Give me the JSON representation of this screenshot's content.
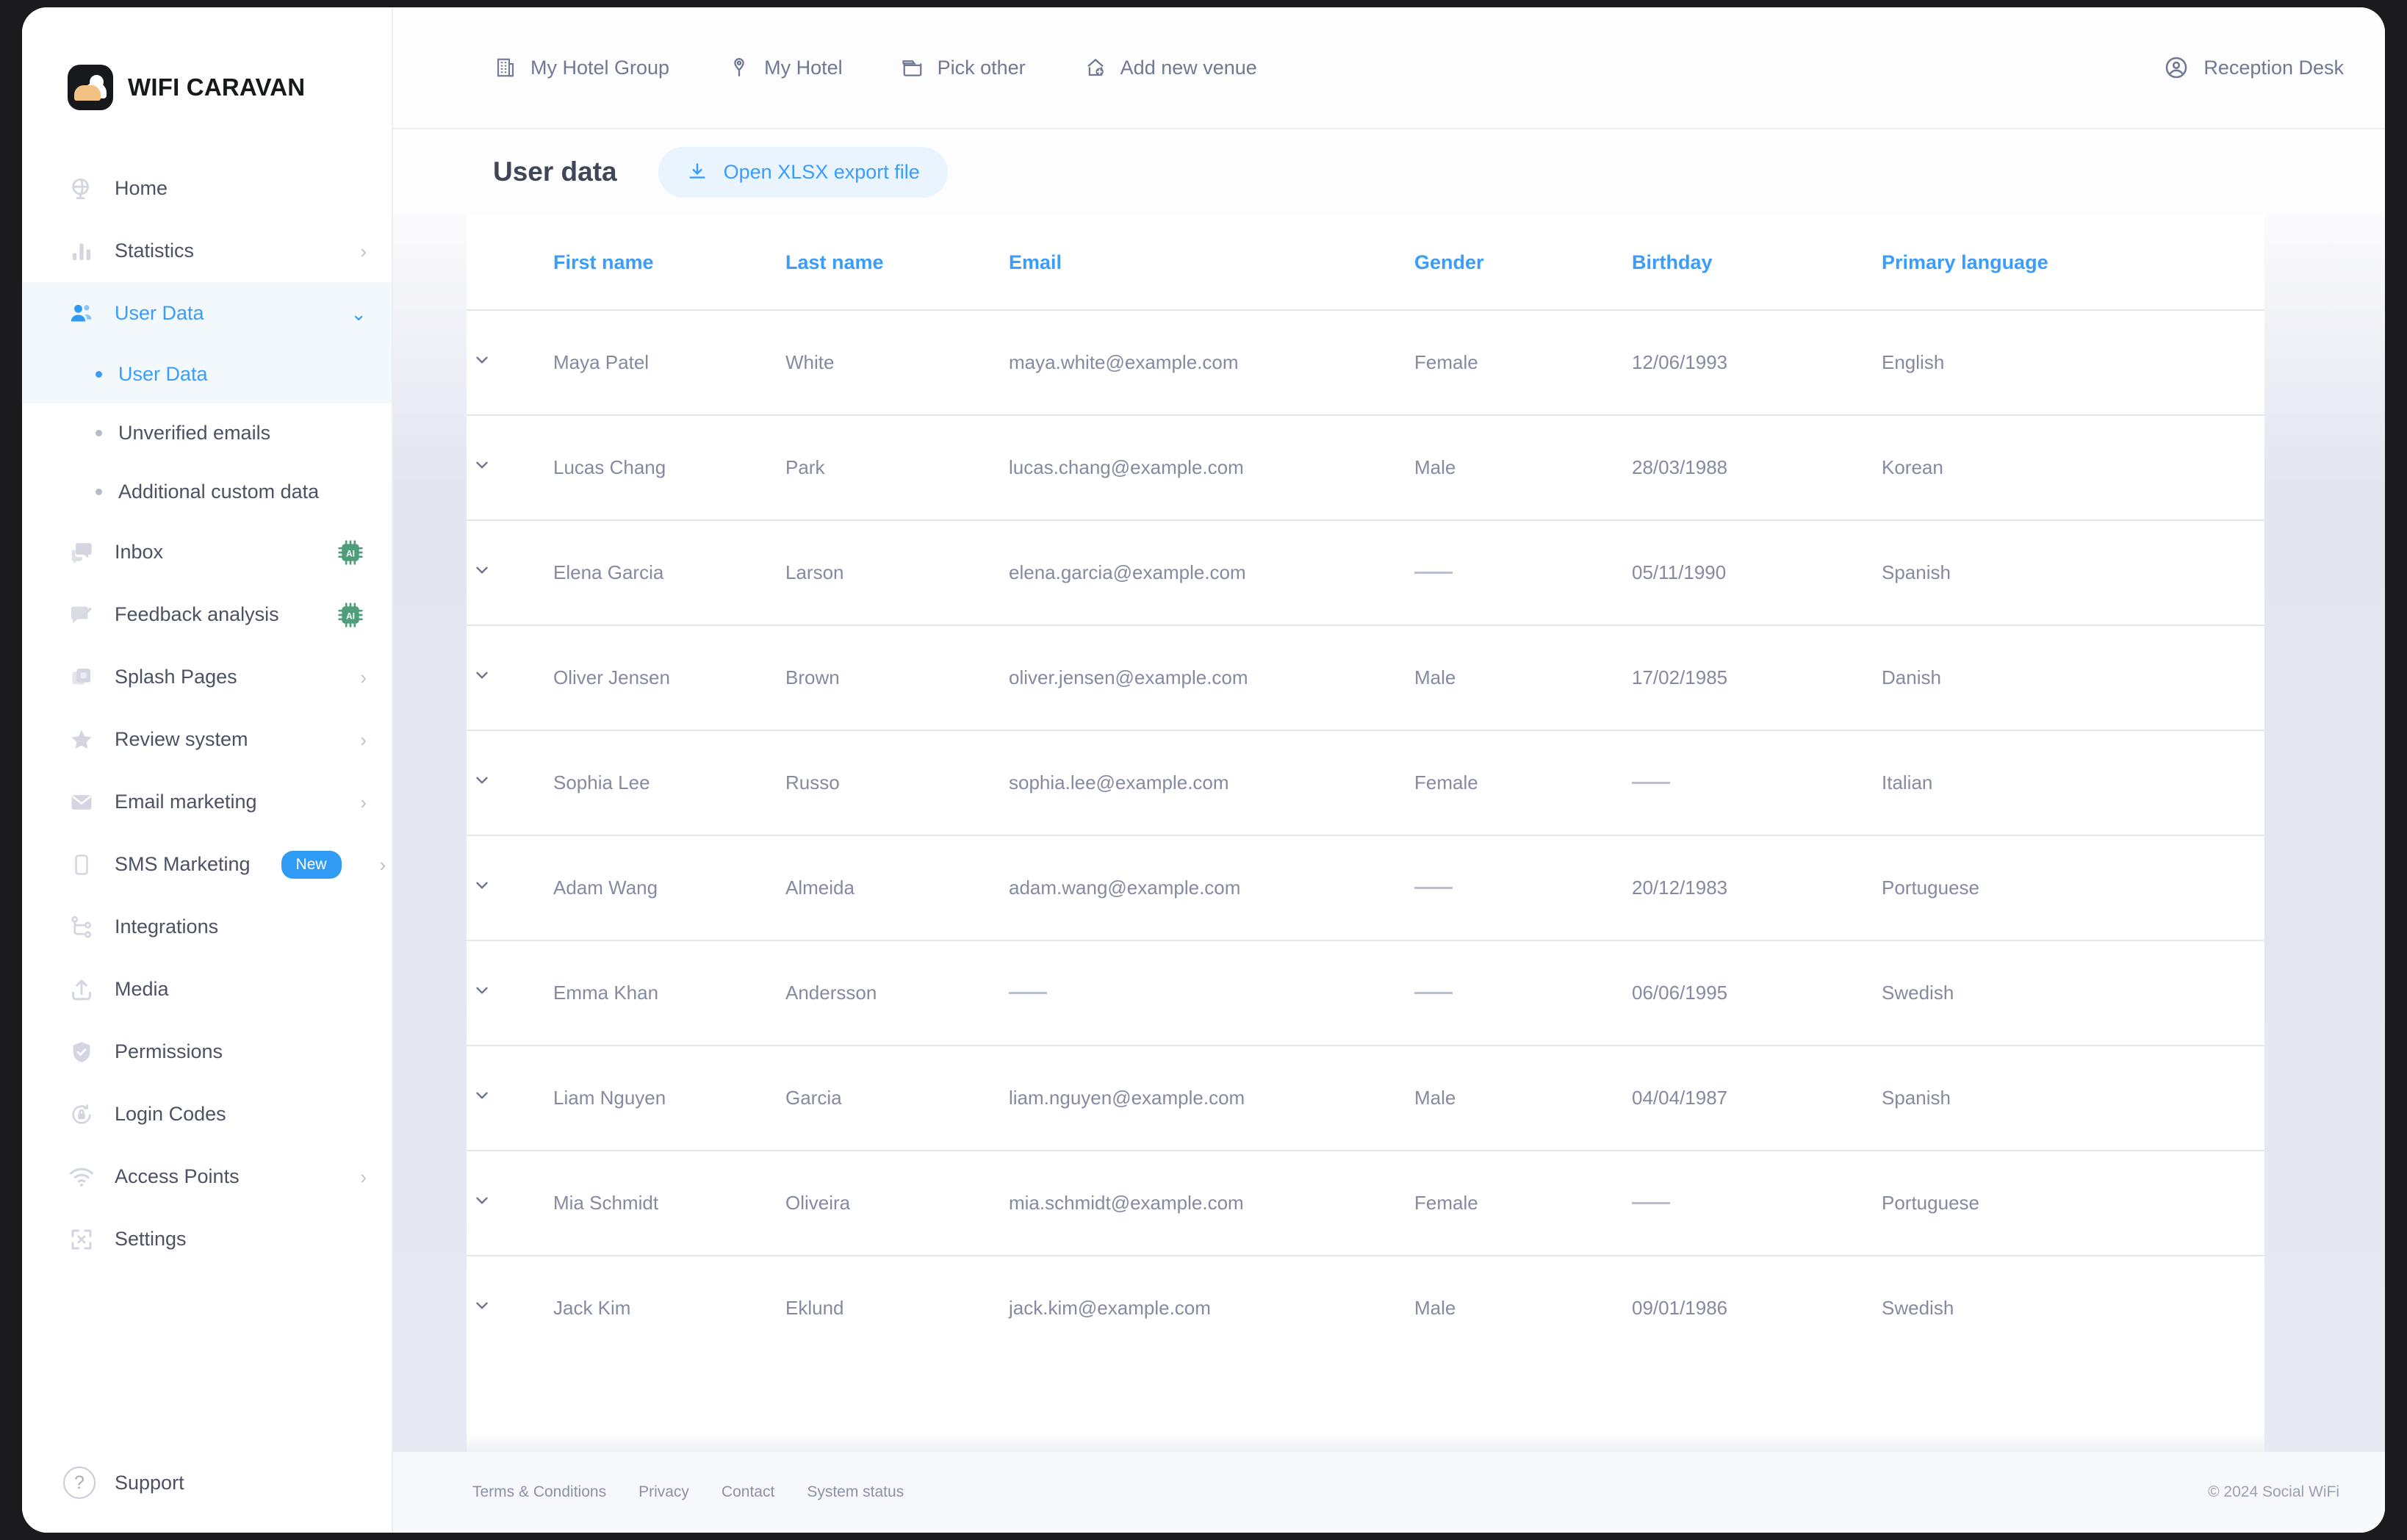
{
  "brand": {
    "name": "WIFI CARAVAN",
    "logo_icon": "cloud-sun-logo-icon"
  },
  "sidebar": {
    "items": [
      {
        "label": "Home",
        "icon": "globe-icon",
        "chevron": "",
        "badge": "",
        "ai": false
      },
      {
        "label": "Statistics",
        "icon": "bar-chart-icon",
        "chevron": "›",
        "badge": "",
        "ai": false
      },
      {
        "label": "User Data",
        "icon": "users-icon",
        "chevron": "⌄",
        "badge": "",
        "ai": false
      }
    ],
    "sub_items": [
      {
        "label": "User Data",
        "active": true
      },
      {
        "label": "Unverified emails",
        "active": false
      },
      {
        "label": "Additional custom data",
        "active": false
      }
    ],
    "items_after": [
      {
        "label": "Inbox",
        "icon": "chat-icon",
        "chevron": "",
        "badge": "",
        "ai": true
      },
      {
        "label": "Feedback analysis",
        "icon": "feedback-icon",
        "chevron": "",
        "badge": "",
        "ai": true
      },
      {
        "label": "Splash Pages",
        "icon": "splash-icon",
        "chevron": "›",
        "badge": "",
        "ai": false
      },
      {
        "label": "Review system",
        "icon": "star-icon",
        "chevron": "›",
        "badge": "",
        "ai": false
      },
      {
        "label": "Email marketing",
        "icon": "envelope-icon",
        "chevron": "›",
        "badge": "",
        "ai": false
      },
      {
        "label": "SMS Marketing",
        "icon": "phone-icon",
        "chevron": "›",
        "badge": "New",
        "ai": false
      },
      {
        "label": "Integrations",
        "icon": "integrations-icon",
        "chevron": "",
        "badge": "",
        "ai": false
      },
      {
        "label": "Media",
        "icon": "upload-icon",
        "chevron": "",
        "badge": "",
        "ai": false
      },
      {
        "label": "Permissions",
        "icon": "shield-check-icon",
        "chevron": "",
        "badge": "",
        "ai": false
      },
      {
        "label": "Login Codes",
        "icon": "lock-refresh-icon",
        "chevron": "",
        "badge": "",
        "ai": false
      },
      {
        "label": "Access Points",
        "icon": "wifi-icon",
        "chevron": "›",
        "badge": "",
        "ai": false
      },
      {
        "label": "Settings",
        "icon": "expand-icon",
        "chevron": "",
        "badge": "",
        "ai": false
      }
    ],
    "support": {
      "label": "Support",
      "icon": "question-circle-icon"
    },
    "ai_badge_label": "AI"
  },
  "topbar": {
    "venues": [
      {
        "label": "My Hotel Group",
        "icon": "building-icon"
      },
      {
        "label": "My Hotel",
        "icon": "map-pin-icon"
      },
      {
        "label": "Pick other",
        "icon": "folder-icon"
      },
      {
        "label": "Add new venue",
        "icon": "home-plus-icon"
      }
    ],
    "user": {
      "label": "Reception Desk",
      "icon": "account-circle-icon"
    }
  },
  "page": {
    "title": "User data",
    "export_label": "Open XLSX export file",
    "export_icon": "download-icon"
  },
  "table": {
    "expand_icon": "chevron-down-icon",
    "empty_value": "—",
    "columns": [
      "First name",
      "Last name",
      "Email",
      "Gender",
      "Birthday",
      "Primary language"
    ],
    "rows": [
      {
        "first_name": "Maya Patel",
        "last_name": "White",
        "email": "maya.white@example.com",
        "gender": "Female",
        "birthday": "12/06/1993",
        "language": "English"
      },
      {
        "first_name": "Lucas Chang",
        "last_name": "Park",
        "email": "lucas.chang@example.com",
        "gender": "Male",
        "birthday": "28/03/1988",
        "language": "Korean"
      },
      {
        "first_name": "Elena Garcia",
        "last_name": "Larson",
        "email": "elena.garcia@example.com",
        "gender": "",
        "birthday": "05/11/1990",
        "language": "Spanish"
      },
      {
        "first_name": "Oliver Jensen",
        "last_name": "Brown",
        "email": "oliver.jensen@example.com",
        "gender": "Male",
        "birthday": "17/02/1985",
        "language": "Danish"
      },
      {
        "first_name": "Sophia Lee",
        "last_name": "Russo",
        "email": "sophia.lee@example.com",
        "gender": "Female",
        "birthday": "",
        "language": "Italian"
      },
      {
        "first_name": "Adam Wang",
        "last_name": "Almeida",
        "email": "adam.wang@example.com",
        "gender": "",
        "birthday": "20/12/1983",
        "language": "Portuguese"
      },
      {
        "first_name": "Emma Khan",
        "last_name": "Andersson",
        "email": "",
        "gender": "",
        "birthday": "06/06/1995",
        "language": "Swedish"
      },
      {
        "first_name": "Liam Nguyen",
        "last_name": "Garcia",
        "email": "liam.nguyen@example.com",
        "gender": "Male",
        "birthday": "04/04/1987",
        "language": "Spanish"
      },
      {
        "first_name": "Mia Schmidt",
        "last_name": "Oliveira",
        "email": "mia.schmidt@example.com",
        "gender": "Female",
        "birthday": "",
        "language": "Portuguese"
      },
      {
        "first_name": "Jack Kim",
        "last_name": "Eklund",
        "email": "jack.kim@example.com",
        "gender": "Male",
        "birthday": "09/01/1986",
        "language": "Swedish"
      }
    ]
  },
  "footer": {
    "links": [
      "Terms & Conditions",
      "Privacy",
      "Contact",
      "System status"
    ],
    "copyright": "© 2024 Social WiFi"
  },
  "colors": {
    "accent": "#3a9dfb",
    "accent_soft": "#e9f4fe",
    "text": "#4b5263",
    "muted": "#848ba1",
    "ai_green": "#4e9e7a",
    "border": "#e4e6ee"
  }
}
